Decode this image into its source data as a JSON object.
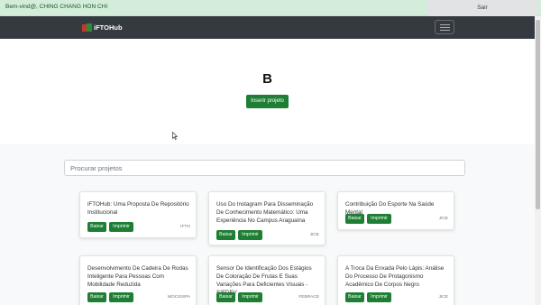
{
  "topbar": {
    "welcome": "Bem-vind@, CHING CHANG HON CHI",
    "logout": "Sair",
    "color": "#d4edda"
  },
  "navbar": {
    "brand": "iFTOHub",
    "bg": "#343a40",
    "menu_icon": "hamburger-icon"
  },
  "hero": {
    "title": "B",
    "insert_button": "Inserir projeto"
  },
  "search": {
    "placeholder": "Procurar projetos",
    "value": ""
  },
  "buttons": {
    "download": "Baixar",
    "print": "Imprimir",
    "color": "#1e7e34"
  },
  "projects": [
    {
      "title": "iFTOHub: Uma Proposta De Repositório Institucional",
      "tag": "IFTO"
    },
    {
      "title": "Uso Do Instagram Para Disseminação De Conhecimento Matemático: Uma Experiência No Campus Araguaína",
      "tag": "JICE"
    },
    {
      "title": "Contribuição Do Esporte Na Saúde Mental",
      "tag": "JICE"
    },
    {
      "title": "Desenvolvimento De Cadeira De Rodas Inteligente Para Pessoas Com Mobilidade Reduzida",
      "tag": "MOCISSPA"
    },
    {
      "title": "Sensor De Identificação Dos Estágios De Coloração De Frutas E Suas Variações Para Deficientes Visuais - SIFDEV",
      "tag": "FEBRACE"
    },
    {
      "title": "A Troca Da Enxada Pelo Lápis: Análise Do Processo De Protagonismo Acadêmico De Corpos Negro",
      "tag": "JICE"
    }
  ]
}
